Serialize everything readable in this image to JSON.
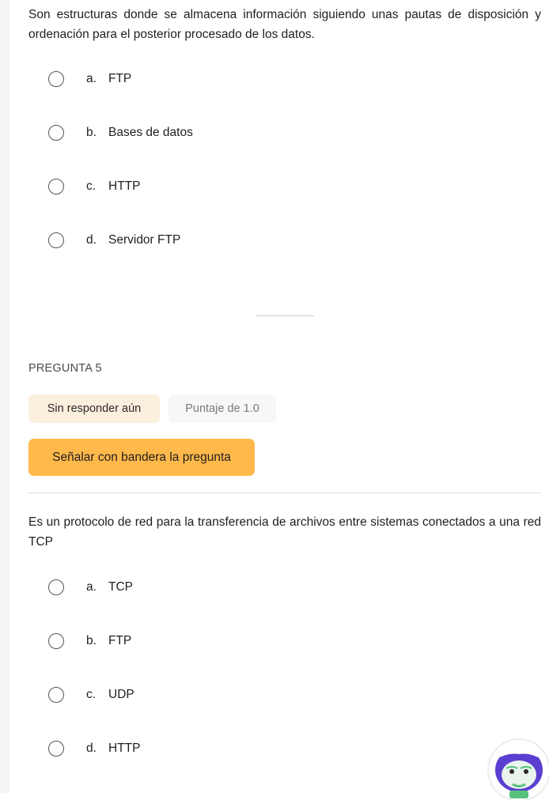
{
  "question4": {
    "text": "Son estructuras donde se almacena información siguiendo unas pautas de disposición y ordenación para el posterior procesado de los datos.",
    "options": [
      {
        "letter": "a.",
        "label": "FTP"
      },
      {
        "letter": "b.",
        "label": "Bases de datos"
      },
      {
        "letter": "c.",
        "label": "HTTP"
      },
      {
        "letter": "d.",
        "label": "Servidor FTP"
      }
    ]
  },
  "question5": {
    "number_label": "PREGUNTA 5",
    "status": "Sin responder aún",
    "score": "Puntaje de 1.0",
    "flag_label": "Señalar con bandera la pregunta",
    "text": "Es un protocolo de red para la transferencia de archivos entre sistemas conectados a una red TCP",
    "options": [
      {
        "letter": "a.",
        "label": "TCP"
      },
      {
        "letter": "b.",
        "label": "FTP"
      },
      {
        "letter": "c.",
        "label": "UDP"
      },
      {
        "letter": "d.",
        "label": "HTTP"
      }
    ]
  },
  "assistant": {
    "icon": "assistant-avatar-icon"
  },
  "colors": {
    "flag_button": "#ffb84a",
    "status_badge": "#fbefdd",
    "assistant_body": "#5a3fd0"
  }
}
